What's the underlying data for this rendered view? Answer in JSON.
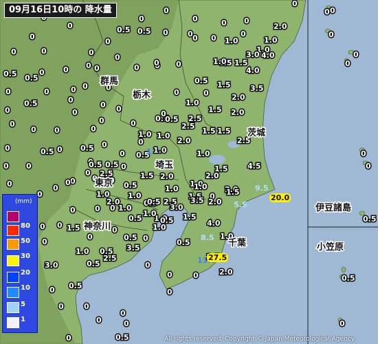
{
  "title": "09月16日10時の 降水量",
  "copyright": "All rights reserved. Copyright © Japan Meteorological Agency",
  "places": {
    "gunma": "群馬",
    "tochigi": "栃木",
    "ibaraki": "茨城",
    "saitama": "埼玉",
    "tokyo": "東京",
    "kanagawa": "神奈川",
    "chiba": "千葉",
    "izu": "伊豆諸島",
    "ogasawara": "小笠原"
  },
  "legend": {
    "unit": "(mm)",
    "levels": [
      {
        "label": "",
        "color": "#b4006e"
      },
      {
        "label": "80",
        "color": "#ff2800"
      },
      {
        "label": "50",
        "color": "#ff9900"
      },
      {
        "label": "30",
        "color": "#faf500"
      },
      {
        "label": "20",
        "color": "#0041ff"
      },
      {
        "label": "10",
        "color": "#218cff"
      },
      {
        "label": "5",
        "color": "#a0d2ff"
      },
      {
        "label": "1",
        "color": "#f2f2ff"
      }
    ]
  },
  "observations": [
    {
      "v": "0",
      "c": ""
    },
    {
      "v": "0.5",
      "c": ""
    },
    {
      "v": "0",
      "c": ""
    },
    {
      "v": "0",
      "c": ""
    },
    {
      "v": "0",
      "c": ""
    },
    {
      "v": "0",
      "c": ""
    },
    {
      "v": "0",
      "c": ""
    },
    {
      "v": "0",
      "c": ""
    },
    {
      "v": "0",
      "c": ""
    },
    {
      "v": "0.5",
      "c": ""
    },
    {
      "v": "0",
      "c": ""
    },
    {
      "v": "0",
      "c": ""
    },
    {
      "v": "0",
      "c": ""
    },
    {
      "v": "0",
      "c": ""
    },
    {
      "v": "0",
      "c": ""
    },
    {
      "v": "0",
      "c": ""
    },
    {
      "v": "0",
      "c": ""
    },
    {
      "v": "1.0",
      "c": ""
    },
    {
      "v": "0",
      "c": ""
    },
    {
      "v": "0",
      "c": ""
    },
    {
      "v": "0",
      "c": ""
    },
    {
      "v": "2.0",
      "c": ""
    },
    {
      "v": "1.0",
      "c": ""
    },
    {
      "v": "1.0",
      "c": ""
    },
    {
      "v": "0.5",
      "c": ""
    },
    {
      "v": "1.5",
      "c": ""
    },
    {
      "v": "3.0",
      "c": ""
    },
    {
      "v": "4.0",
      "c": ""
    },
    {
      "v": "1.0",
      "c": ""
    },
    {
      "v": "4.0",
      "c": ""
    },
    {
      "v": "0",
      "c": ""
    },
    {
      "v": "0.5",
      "c": ""
    },
    {
      "v": "0",
      "c": ""
    },
    {
      "v": "0",
      "c": ""
    },
    {
      "v": "0",
      "c": ""
    },
    {
      "v": "0",
      "c": ""
    },
    {
      "v": "0.5",
      "c": ""
    },
    {
      "v": "0",
      "c": ""
    },
    {
      "v": "0",
      "c": ""
    },
    {
      "v": "0",
      "c": ""
    },
    {
      "v": "0",
      "c": ""
    },
    {
      "v": "0.5",
      "c": ""
    },
    {
      "v": "1.5",
      "c": ""
    },
    {
      "v": "3.5",
      "c": ""
    },
    {
      "v": "0",
      "c": ""
    },
    {
      "v": "0",
      "c": ""
    },
    {
      "v": "0",
      "c": ""
    },
    {
      "v": "0",
      "c": ""
    },
    {
      "v": "0",
      "c": ""
    },
    {
      "v": "0",
      "c": ""
    },
    {
      "v": "0.5",
      "c": ""
    },
    {
      "v": "0",
      "c": ""
    },
    {
      "v": "0",
      "c": ""
    },
    {
      "v": "0",
      "c": ""
    },
    {
      "v": "1.0",
      "c": ""
    },
    {
      "v": "2.0",
      "c": ""
    },
    {
      "v": "0",
      "c": ""
    },
    {
      "v": "0",
      "c": ""
    },
    {
      "v": "0.5",
      "c": ""
    },
    {
      "v": "2.5",
      "c": ""
    },
    {
      "v": "1.5",
      "c": ""
    },
    {
      "v": "2.0",
      "c": ""
    },
    {
      "v": "0",
      "c": ""
    },
    {
      "v": "0",
      "c": ""
    },
    {
      "v": "0",
      "c": ""
    },
    {
      "v": "0",
      "c": ""
    },
    {
      "v": "0",
      "c": ""
    },
    {
      "v": "0",
      "c": ""
    },
    {
      "v": "0",
      "c": ""
    },
    {
      "v": "2.5",
      "c": ""
    },
    {
      "v": "1.5",
      "c": ""
    },
    {
      "v": "1.5",
      "c": ""
    },
    {
      "v": "0.5",
      "c": ""
    },
    {
      "v": "1.0",
      "c": ""
    },
    {
      "v": "0",
      "c": ""
    },
    {
      "v": "0",
      "c": ""
    },
    {
      "v": "0",
      "c": ""
    },
    {
      "v": "0.5",
      "c": ""
    },
    {
      "v": "0",
      "c": ""
    },
    {
      "v": "1.0",
      "c": ""
    },
    {
      "v": "2.0",
      "c": ""
    },
    {
      "v": "2.5",
      "c": ""
    },
    {
      "v": "0",
      "c": ""
    },
    {
      "v": "0.5",
      "c": ""
    },
    {
      "v": "1.0",
      "c": "c10"
    },
    {
      "v": "1.0",
      "c": ""
    },
    {
      "v": "0",
      "c": ""
    },
    {
      "v": "0.5",
      "c": ""
    },
    {
      "v": "0",
      "c": ""
    },
    {
      "v": "0",
      "c": ""
    },
    {
      "v": "0.5",
      "c": ""
    },
    {
      "v": "0",
      "c": ""
    },
    {
      "v": "0.5",
      "c": ""
    },
    {
      "v": "0.5",
      "c": ""
    },
    {
      "v": "1.0",
      "c": ""
    },
    {
      "v": "4.5",
      "c": ""
    },
    {
      "v": "0",
      "c": ""
    },
    {
      "v": "0",
      "c": ""
    },
    {
      "v": "2.5",
      "c": ""
    },
    {
      "v": "0",
      "c": ""
    },
    {
      "v": "1.5",
      "c": ""
    },
    {
      "v": "2.0",
      "c": ""
    },
    {
      "v": "2.0",
      "c": ""
    },
    {
      "v": "0",
      "c": ""
    },
    {
      "v": "1.0",
      "c": ""
    },
    {
      "v": "1.5",
      "c": ""
    },
    {
      "v": "2.0",
      "c": ""
    },
    {
      "v": "0.5",
      "c": ""
    },
    {
      "v": "1.0",
      "c": ""
    },
    {
      "v": "0",
      "c": ""
    },
    {
      "v": "1.0",
      "c": ""
    },
    {
      "v": "9.5",
      "c": "c5"
    },
    {
      "v": "0",
      "c": ""
    },
    {
      "v": "1.0",
      "c": ""
    },
    {
      "v": "0",
      "c": ""
    },
    {
      "v": "1.5",
      "c": ""
    },
    {
      "v": "0",
      "c": ""
    },
    {
      "v": "1.0",
      "c": ""
    },
    {
      "v": "3.5",
      "c": ""
    },
    {
      "v": "2.0",
      "c": ""
    },
    {
      "v": "1.5",
      "c": ""
    },
    {
      "v": "20.0",
      "c": "c20"
    },
    {
      "v": "0",
      "c": ""
    },
    {
      "v": "0",
      "c": ""
    },
    {
      "v": "1.0",
      "c": ""
    },
    {
      "v": "0.5",
      "c": ""
    },
    {
      "v": "2.5",
      "c": ""
    },
    {
      "v": "3.0",
      "c": ""
    },
    {
      "v": "5.5",
      "c": "c5"
    },
    {
      "v": "0",
      "c": ""
    },
    {
      "v": "0",
      "c": ""
    },
    {
      "v": "1.0",
      "c": ""
    },
    {
      "v": "0",
      "c": ""
    },
    {
      "v": "1.5",
      "c": ""
    },
    {
      "v": "2.0",
      "c": ""
    },
    {
      "v": "1.0",
      "c": ""
    },
    {
      "v": "0",
      "c": ""
    },
    {
      "v": "0.5",
      "c": ""
    },
    {
      "v": "0.5",
      "c": ""
    },
    {
      "v": "0.5",
      "c": ""
    },
    {
      "v": "1.0",
      "c": ""
    },
    {
      "v": "4.0",
      "c": ""
    },
    {
      "v": "0",
      "c": ""
    },
    {
      "v": "0.5",
      "c": ""
    },
    {
      "v": "0",
      "c": ""
    },
    {
      "v": "1.0",
      "c": ""
    },
    {
      "v": "1.5",
      "c": ""
    },
    {
      "v": "0.5",
      "c": ""
    },
    {
      "v": "0",
      "c": ""
    },
    {
      "v": "0",
      "c": ""
    },
    {
      "v": "0.5",
      "c": ""
    },
    {
      "v": "0.5",
      "c": ""
    },
    {
      "v": "8.5",
      "c": "c5"
    },
    {
      "v": "1.0",
      "c": ""
    },
    {
      "v": "3.0",
      "c": ""
    },
    {
      "v": "2.5",
      "c": ""
    },
    {
      "v": "13.0",
      "c": "c10"
    },
    {
      "v": "1.5",
      "c": ""
    },
    {
      "v": "27.5",
      "c": "c20"
    },
    {
      "v": "3.5",
      "c": ""
    },
    {
      "v": "0",
      "c": ""
    },
    {
      "v": "0",
      "c": ""
    },
    {
      "v": "0",
      "c": ""
    },
    {
      "v": "2.0",
      "c": ""
    },
    {
      "v": "0",
      "c": ""
    },
    {
      "v": "0",
      "c": ""
    },
    {
      "v": "0",
      "c": ""
    },
    {
      "v": "0",
      "c": ""
    },
    {
      "v": "0",
      "c": ""
    },
    {
      "v": "0",
      "c": ""
    },
    {
      "v": "0",
      "c": ""
    },
    {
      "v": "0",
      "c": ""
    },
    {
      "v": "0",
      "c": ""
    },
    {
      "v": "0",
      "c": ""
    },
    {
      "v": "0",
      "c": ""
    },
    {
      "v": "0",
      "c": ""
    },
    {
      "v": "0",
      "c": ""
    },
    {
      "v": "0",
      "c": ""
    },
    {
      "v": "0",
      "c": ""
    },
    {
      "v": "0",
      "c": ""
    },
    {
      "v": "0",
      "c": ""
    },
    {
      "v": "0.5",
      "c": ""
    },
    {
      "v": "0.5",
      "c": ""
    },
    {
      "v": "0",
      "c": ""
    },
    {
      "v": "0.5",
      "c": ""
    },
    {
      "v": "0.5",
      "c": ""
    },
    {
      "v": "0",
      "c": ""
    },
    {
      "v": "0",
      "c": ""
    },
    {
      "v": "0",
      "c": ""
    },
    {
      "v": "0",
      "c": ""
    },
    {
      "v": "0.5",
      "c": ""
    },
    {
      "v": "0",
      "c": ""
    },
    {
      "v": "0",
      "c": ""
    },
    {
      "v": "0",
      "c": ""
    }
  ]
}
